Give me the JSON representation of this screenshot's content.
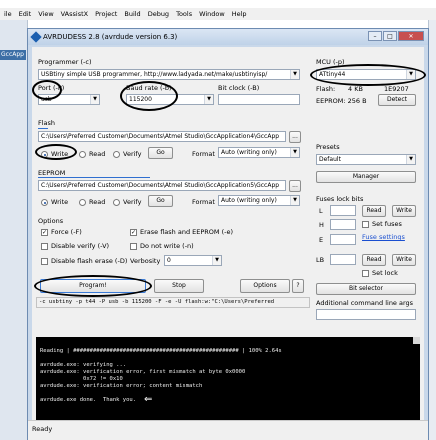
{
  "ide": {
    "menu": [
      "ile",
      "Edit",
      "View",
      "VAssistX",
      "Project",
      "Build",
      "Debug",
      "Tools",
      "Window",
      "Help"
    ],
    "tab": "GccApp"
  },
  "window": {
    "title": "AVRDUDESS 2.8 (avrdude version 6.3)"
  },
  "programmer": {
    "label": "Programmer (-c)",
    "value": "USBtiny simple USB programmer, http://www.ladyada.net/make/usbtinyisp/"
  },
  "port": {
    "label": "Port (-P)",
    "value": "usb"
  },
  "baud": {
    "label": "Baud rate (-b)",
    "value": "115200"
  },
  "bitclock": {
    "label": "Bit clock (-B)",
    "value": ""
  },
  "flash": {
    "label": "Flash",
    "path": "C:\\Users\\Preferred Customer\\Documents\\Atmel Studio\\GccApplication4\\GccApp",
    "browse": "...",
    "write": "Write",
    "read": "Read",
    "verify": "Verify",
    "go": "Go",
    "format_label": "Format",
    "format": "Auto (writing only)"
  },
  "eeprom": {
    "label": "EEPROM",
    "path": "C:\\Users\\Preferred Customer\\Documents\\Atmel Studio\\GccApplication5\\GccApp",
    "browse": "...",
    "write": "Write",
    "read": "Read",
    "verify": "Verify",
    "go": "Go",
    "format_label": "Format",
    "format": "Auto (writing only)"
  },
  "options": {
    "label": "Options",
    "force": "Force (-F)",
    "erase": "Erase flash and EEPROM (-e)",
    "disable_verify": "Disable verify (-V)",
    "no_write": "Do not write (-n)",
    "disable_flash_erase": "Disable flash erase (-D)",
    "verbosity_label": "Verbosity",
    "verbosity": "0"
  },
  "actions": {
    "program": "Program!",
    "stop": "Stop",
    "options": "Options",
    "help": "?"
  },
  "mcu": {
    "label": "MCU (-p)",
    "value": "ATtiny44",
    "flash_label": "Flash:",
    "flash": "4 KB",
    "sig": "1E9207",
    "eeprom": "EEPROM: 256 B",
    "detect": "Detect"
  },
  "presets": {
    "label": "Presets",
    "value": "Default",
    "manager": "Manager"
  },
  "fuses": {
    "label": "Fuses lock bits",
    "l": "L",
    "h": "H",
    "e": "E",
    "lb": "LB",
    "read": "Read",
    "write": "Write",
    "set_fuses": "Set fuses",
    "fuse_settings": "Fuse settings",
    "set_lock": "Set lock",
    "bit_selector": "Bit selector"
  },
  "additional": {
    "label": "Additional command line args"
  },
  "command": "-c usbtiny -p t44 -P usb -b 115200 -F -e -U flash:w:\"C:\\Users\\Preferred",
  "console": [
    "",
    "Reading | ################################################## | 100% 2.64s",
    "",
    "avrdude.exe: verifying ...",
    "avrdude.exe: verification error, first mismatch at byte 0x0000",
    "             0x72 != 0x10",
    "avrdude.exe: verification error; content mismatch",
    "",
    "avrdude.exe done.  Thank you."
  ],
  "status": "Ready",
  "colors": {
    "accent": "#2f6fd0",
    "console_bg": "#000000"
  }
}
